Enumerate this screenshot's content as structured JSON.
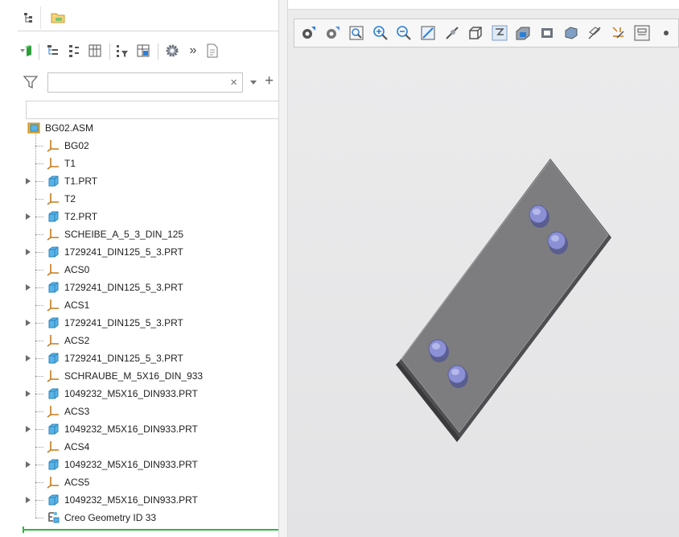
{
  "panel_tabs": [
    {
      "name": "model-tree-tab",
      "icon": "tree-icon"
    },
    {
      "name": "folder-browser-tab",
      "icon": "folder-icon"
    }
  ],
  "tree_toolbar": {
    "more_label": "»"
  },
  "filter": {
    "search_value": "",
    "search_placeholder": "",
    "clear_glyph": "×",
    "add_glyph": "+"
  },
  "tree": {
    "root": {
      "label": "BG02.ASM",
      "icon": "assembly-icon"
    },
    "items": [
      {
        "label": "BG02",
        "type": "csys",
        "expandable": false
      },
      {
        "label": "T1",
        "type": "csys",
        "expandable": false
      },
      {
        "label": "T1.PRT",
        "type": "part",
        "expandable": true
      },
      {
        "label": "T2",
        "type": "csys",
        "expandable": false
      },
      {
        "label": "T2.PRT",
        "type": "part",
        "expandable": true
      },
      {
        "label": "SCHEIBE_A_5_3_DIN_125",
        "type": "csys",
        "expandable": false
      },
      {
        "label": "1729241_DIN125_5_3.PRT",
        "type": "part",
        "expandable": true
      },
      {
        "label": "ACS0",
        "type": "csys",
        "expandable": false
      },
      {
        "label": "1729241_DIN125_5_3.PRT",
        "type": "part",
        "expandable": true
      },
      {
        "label": "ACS1",
        "type": "csys",
        "expandable": false
      },
      {
        "label": "1729241_DIN125_5_3.PRT",
        "type": "part",
        "expandable": true
      },
      {
        "label": "ACS2",
        "type": "csys",
        "expandable": false
      },
      {
        "label": "1729241_DIN125_5_3.PRT",
        "type": "part",
        "expandable": true
      },
      {
        "label": "SCHRAUBE_M_5X16_DIN_933",
        "type": "csys",
        "expandable": false
      },
      {
        "label": "1049232_M5X16_DIN933.PRT",
        "type": "part",
        "expandable": true
      },
      {
        "label": "ACS3",
        "type": "csys",
        "expandable": false
      },
      {
        "label": "1049232_M5X16_DIN933.PRT",
        "type": "part",
        "expandable": true
      },
      {
        "label": "ACS4",
        "type": "csys",
        "expandable": false
      },
      {
        "label": "1049232_M5X16_DIN933.PRT",
        "type": "part",
        "expandable": true
      },
      {
        "label": "ACS5",
        "type": "csys",
        "expandable": false
      },
      {
        "label": "1049232_M5X16_DIN933.PRT",
        "type": "part",
        "expandable": true
      },
      {
        "label": "Creo Geometry ID 33",
        "type": "geometry",
        "expandable": false
      }
    ]
  },
  "view_toolbar": {
    "icons": [
      "saved-views-icon",
      "view-manager-icon",
      "refit-icon",
      "zoom-in-icon",
      "zoom-out-icon",
      "repaint-icon",
      "spin-center-icon",
      "named-view-icon",
      "orient-icon",
      "display-style-icon",
      "section-icon",
      "perspective-icon",
      "shaded-icon",
      "datum-display-icon",
      "annotation-display-icon",
      "more-filters-icon"
    ]
  },
  "colors": {
    "accent_green": "#2db83d",
    "part_blue": "#58b3e6",
    "viewport_bg": "#e8e8ea",
    "plate_face": "#7d7d80",
    "plate_edge": "#3f3f42",
    "bolt_blue": "#8c90d4"
  }
}
